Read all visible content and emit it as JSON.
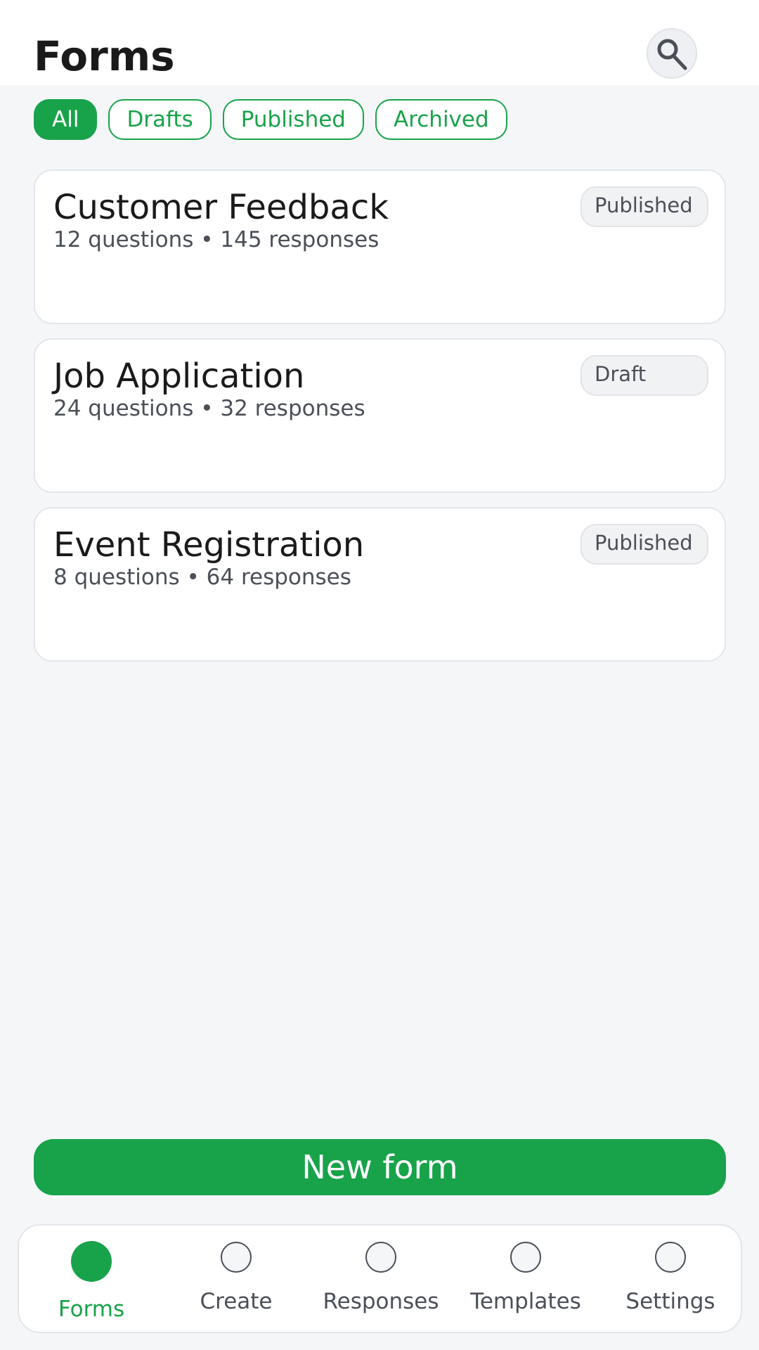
{
  "header": {
    "title": "Forms",
    "search_icon": "search-icon"
  },
  "filters": [
    {
      "label": "All",
      "active": true
    },
    {
      "label": "Drafts",
      "active": false
    },
    {
      "label": "Published",
      "active": false
    },
    {
      "label": "Archived",
      "active": false
    }
  ],
  "forms": [
    {
      "title": "Customer Feedback",
      "meta": "12 questions • 145 responses",
      "status": "Published"
    },
    {
      "title": "Job Application",
      "meta": "24 questions • 32 responses",
      "status": "Draft"
    },
    {
      "title": "Event Registration",
      "meta": "8 questions • 64 responses",
      "status": "Published"
    }
  ],
  "primary_action": {
    "label": "New form"
  },
  "bottom_nav": [
    {
      "label": "Forms",
      "active": true
    },
    {
      "label": "Create",
      "active": false
    },
    {
      "label": "Responses",
      "active": false
    },
    {
      "label": "Templates",
      "active": false
    },
    {
      "label": "Settings",
      "active": false
    }
  ],
  "colors": {
    "accent": "#18a34a",
    "background": "#f4f6f8",
    "surface": "#ffffff",
    "text_primary": "#1a1a1a",
    "text_secondary": "#4b4f58"
  }
}
